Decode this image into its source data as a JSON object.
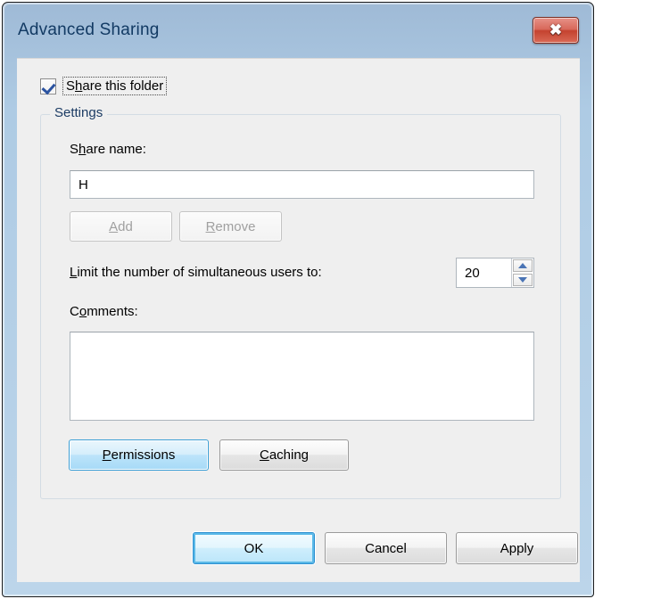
{
  "window": {
    "title": "Advanced Sharing",
    "close_icon": "close-icon",
    "close_glyph": "✖"
  },
  "share_folder": {
    "label_prefix": "S",
    "label_accel": "h",
    "label_suffix": "are this folder",
    "checked": true
  },
  "settings_group": {
    "legend": "Settings",
    "share_name": {
      "label_prefix": "S",
      "label_accel": "h",
      "label_suffix": "are name:",
      "value": "H",
      "placeholder": ""
    },
    "add_button": {
      "label_accel": "A",
      "label_suffix": "dd",
      "disabled": true
    },
    "remove_button": {
      "label_accel": "R",
      "label_suffix": "emove",
      "disabled": true
    },
    "user_limit": {
      "label_accel": "L",
      "label_suffix": "imit the number of simultaneous users to:",
      "value": "20",
      "spin_up_icon": "chevron-up-icon",
      "spin_down_icon": "chevron-down-icon"
    },
    "comments": {
      "label_prefix": "C",
      "label_accel": "o",
      "label_suffix": "mments:",
      "value": ""
    },
    "permissions_button": {
      "label_accel": "P",
      "label_suffix": "ermissions"
    },
    "caching_button": {
      "label_accel": "C",
      "label_suffix": "aching"
    }
  },
  "footer": {
    "ok_label": "OK",
    "cancel_label": "Cancel",
    "apply_label": "Apply"
  },
  "colors": {
    "titlebar_top": "#9fbad6",
    "titlebar_bottom": "#bcd5ea",
    "client_bg": "#efefef",
    "close_red": "#c4422f",
    "accent_blue": "#2c8fd0",
    "title_text": "#123a63"
  }
}
